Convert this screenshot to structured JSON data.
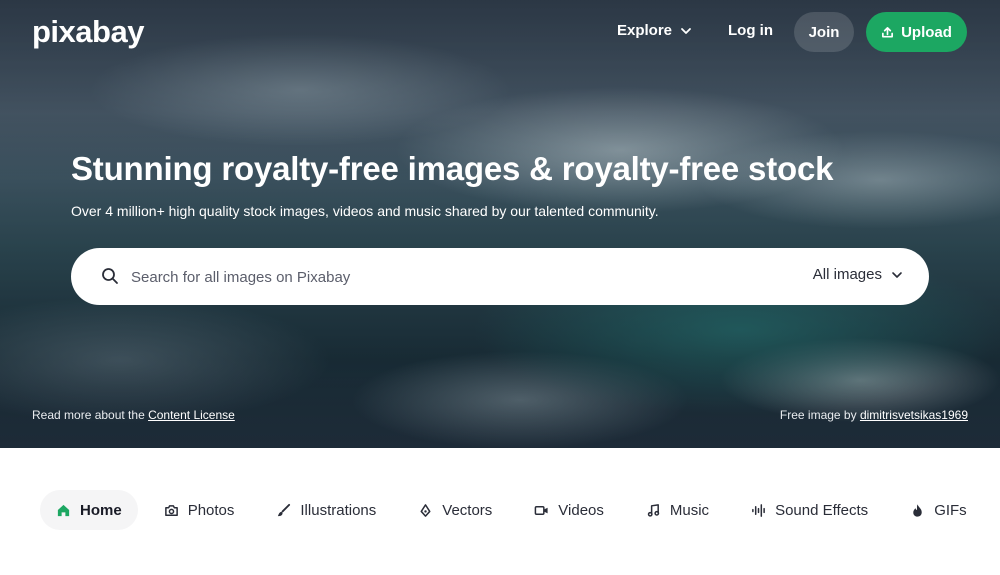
{
  "header": {
    "logo_text": "pixabay",
    "nav": {
      "explore_label": "Explore",
      "login_label": "Log in",
      "join_label": "Join",
      "upload_label": "Upload"
    }
  },
  "hero": {
    "headline": "Stunning royalty-free images & royalty-free stock",
    "subline": "Over 4 million+ high quality stock images, videos and music shared by our talented community.",
    "search": {
      "placeholder": "Search for all images on Pixabay",
      "value": "",
      "type_label": "All images"
    },
    "credit_left_prefix": "Read more about the ",
    "credit_left_link": "Content License",
    "credit_right_prefix": "Free image by ",
    "credit_right_link": "dimitrisvetsikas1969"
  },
  "tabs": [
    {
      "label": "Home",
      "icon": "home-icon",
      "active": true
    },
    {
      "label": "Photos",
      "icon": "camera-icon",
      "active": false
    },
    {
      "label": "Illustrations",
      "icon": "brush-icon",
      "active": false
    },
    {
      "label": "Vectors",
      "icon": "pen-nib-icon",
      "active": false
    },
    {
      "label": "Videos",
      "icon": "video-icon",
      "active": false
    },
    {
      "label": "Music",
      "icon": "music-note-icon",
      "active": false
    },
    {
      "label": "Sound Effects",
      "icon": "waveform-icon",
      "active": false
    },
    {
      "label": "GIFs",
      "icon": "flame-icon",
      "active": false
    }
  ],
  "colors": {
    "brand_green": "#1ca762",
    "text_dark": "#191b26",
    "active_tab_bg": "#f5f5f6"
  }
}
